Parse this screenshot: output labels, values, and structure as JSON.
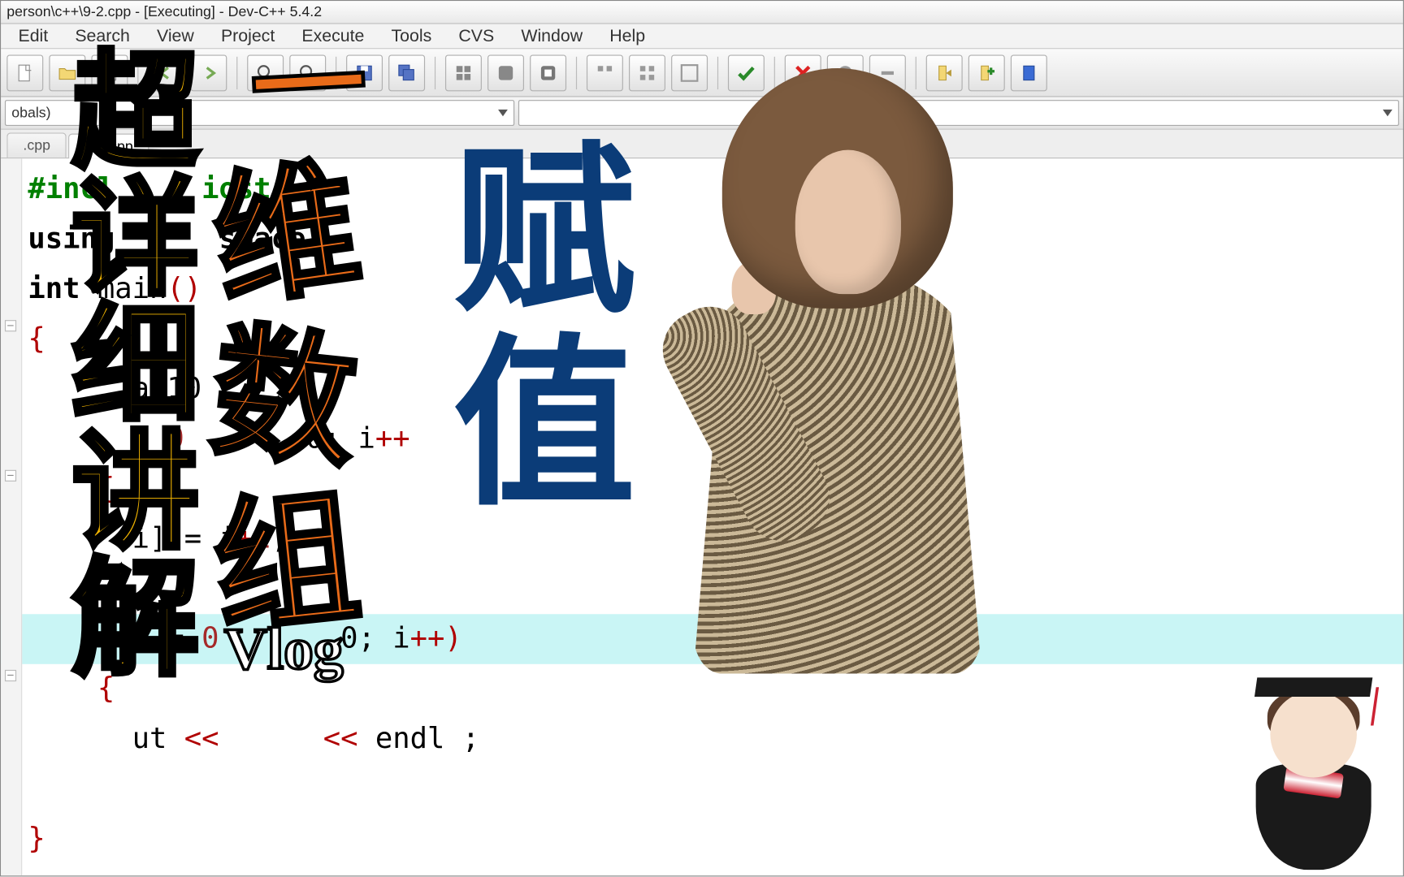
{
  "titlebar": "person\\c++\\9-2.cpp - [Executing] - Dev-C++ 5.4.2",
  "menu": {
    "items": [
      "Edit",
      "Search",
      "View",
      "Project",
      "Execute",
      "Tools",
      "CVS",
      "Window",
      "Help"
    ]
  },
  "selectors": {
    "globals": "obals)",
    "right": ""
  },
  "tabs": {
    "items": [
      ".cpp",
      "9-2.cpp"
    ],
    "active": 1
  },
  "code": {
    "l1a": "#incl",
    "l1b": "iostr",
    "l2a": "using",
    "l2b": "space",
    "l3a": "int ",
    "l3b": "main",
    "l3c": "()",
    "l4": "{",
    "l5a": "      ",
    "l5b": "a[10",
    "l5c": ";",
    "l6a": "      = ",
    "l6b": "0",
    "l6c": "       0; i",
    "l6d": "++",
    "l7": "    {",
    "l8a": "      i] = i",
    "l8b": "+",
    "l8c": "2",
    "l8d": ";",
    "l9": "",
    "l10a": "        = ",
    "l10b": "0",
    "l10c": "       0; i",
    "l10d": "++",
    "l10e": ")",
    "l11": "    {",
    "l12a": "      ut ",
    "l12b": "<<",
    "l12c": "      ",
    "l12d": "<<",
    "l12e": " endl ;",
    "l13": "",
    "l14": "}"
  },
  "overlay": {
    "yellow": "超\n详\n细\n讲\n解",
    "orangeTop": "一",
    "orange1": "维",
    "orange2": "数",
    "orange3": "组",
    "blue": "赋\n值",
    "vlog": "Vlog"
  }
}
